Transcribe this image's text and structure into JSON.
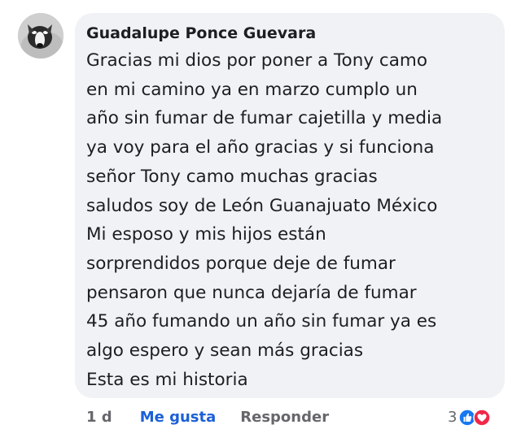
{
  "comment": {
    "author": "Guadalupe Ponce Guevara",
    "lines": [
      "Gracias mi dios por poner a Tony camo",
      "en mi camino ya en marzo cumplo un",
      "año sin fumar de fumar cajetilla y media",
      "ya voy para el año gracias y si funciona",
      "señor Tony camo muchas gracias",
      "saludos soy de León Guanajuato México",
      "Mi esposo y mis hijos están",
      "sorprendidos porque deje de fumar",
      "pensaron que nunca dejaría de fumar",
      "45 año fumando un año sin fumar ya es",
      "algo espero y sean más gracias",
      "Esta es mi  historia"
    ],
    "bubble_color": "#f0f2f5"
  },
  "actions": {
    "time": "1 d",
    "like_label": "Me gusta",
    "reply_label": "Responder",
    "like_color": "#1b60d6"
  },
  "reactions": {
    "count": "3",
    "icons": [
      "like-reaction-icon",
      "love-reaction-icon"
    ],
    "like_color": "#1877f2",
    "love_color": "#f02849"
  }
}
